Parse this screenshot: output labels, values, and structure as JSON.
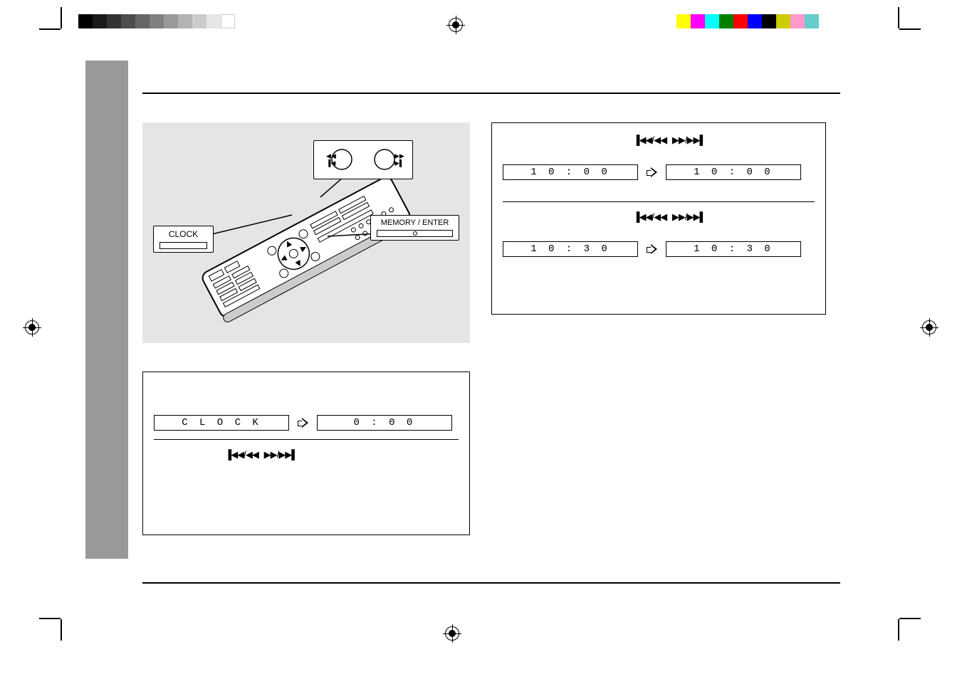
{
  "callouts": {
    "clock": "CLOCK",
    "memory_enter": "MEMORY / ENTER"
  },
  "icons": {
    "skip_back": "▐◀◀/◀◀",
    "skip_fwd": "▶▶/▶▶▌",
    "prev": "◀◀",
    "next": "▶▶"
  },
  "step1": {
    "lcd1": "C L O C K",
    "lcd2": "0 : 0 0"
  },
  "step2a": {
    "lcd1": "1 0 : 0 0",
    "lcd2": "1 0 : 0 0"
  },
  "step2b": {
    "lcd1": "1 0 : 3 0",
    "lcd2": "1 0 : 3 0"
  },
  "gray_bar": [
    "#000000",
    "#1a1a1a",
    "#333333",
    "#4d4d4d",
    "#666666",
    "#808080",
    "#999999",
    "#b3b3b3",
    "#cccccc",
    "#e6e6e6",
    "#ffffff"
  ],
  "color_bar_right": [
    "#ffff00",
    "#ff00ff",
    "#00ffff",
    "#008000",
    "#ff0000",
    "#0000ff",
    "#000000",
    "#cccc00",
    "#ff99cc",
    "#66cccc"
  ]
}
